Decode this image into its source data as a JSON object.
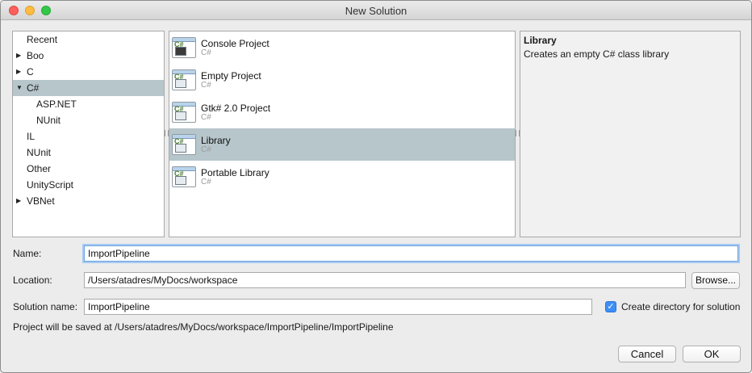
{
  "window": {
    "title": "New Solution"
  },
  "categories": [
    {
      "label": "Recent",
      "expander": "",
      "level": 0,
      "selected": false
    },
    {
      "label": "Boo",
      "expander": "▶",
      "level": 0,
      "selected": false
    },
    {
      "label": "C",
      "expander": "▶",
      "level": 0,
      "selected": false
    },
    {
      "label": "C#",
      "expander": "▼",
      "level": 0,
      "selected": true
    },
    {
      "label": "ASP.NET",
      "expander": "",
      "level": 1,
      "selected": false
    },
    {
      "label": "NUnit",
      "expander": "",
      "level": 1,
      "selected": false
    },
    {
      "label": "IL",
      "expander": "",
      "level": 0,
      "selected": false
    },
    {
      "label": "NUnit",
      "expander": "",
      "level": 0,
      "selected": false
    },
    {
      "label": "Other",
      "expander": "",
      "level": 0,
      "selected": false
    },
    {
      "label": "UnityScript",
      "expander": "",
      "level": 0,
      "selected": false
    },
    {
      "label": "VBNet",
      "expander": "▶",
      "level": 0,
      "selected": false
    }
  ],
  "templates": [
    {
      "name": "Console Project",
      "lang": "C#",
      "icon": "console-project-icon",
      "selected": false
    },
    {
      "name": "Empty Project",
      "lang": "C#",
      "icon": "empty-project-icon",
      "selected": false
    },
    {
      "name": "Gtk# 2.0 Project",
      "lang": "C#",
      "icon": "gtk-project-icon",
      "selected": false
    },
    {
      "name": "Library",
      "lang": "C#",
      "icon": "library-icon",
      "selected": true
    },
    {
      "name": "Portable Library",
      "lang": "C#",
      "icon": "portable-library-icon",
      "selected": false
    }
  ],
  "description": {
    "title": "Library",
    "text": "Creates an empty C# class library"
  },
  "form": {
    "name_label": "Name:",
    "name_value": "ImportPipeline",
    "location_label": "Location:",
    "location_value": "/Users/atadres/MyDocs/workspace",
    "browse_label": "Browse...",
    "solution_label": "Solution name:",
    "solution_value": "ImportPipeline",
    "create_dir_label": "Create directory for solution",
    "create_dir_checked": true,
    "save_path_text": "Project will be saved at /Users/atadres/MyDocs/workspace/ImportPipeline/ImportPipeline"
  },
  "buttons": {
    "cancel": "Cancel",
    "ok": "OK"
  },
  "colors": {
    "selection": "#b6c6cb",
    "checkbox": "#3e8ef7",
    "focus": "#6da4e0"
  }
}
